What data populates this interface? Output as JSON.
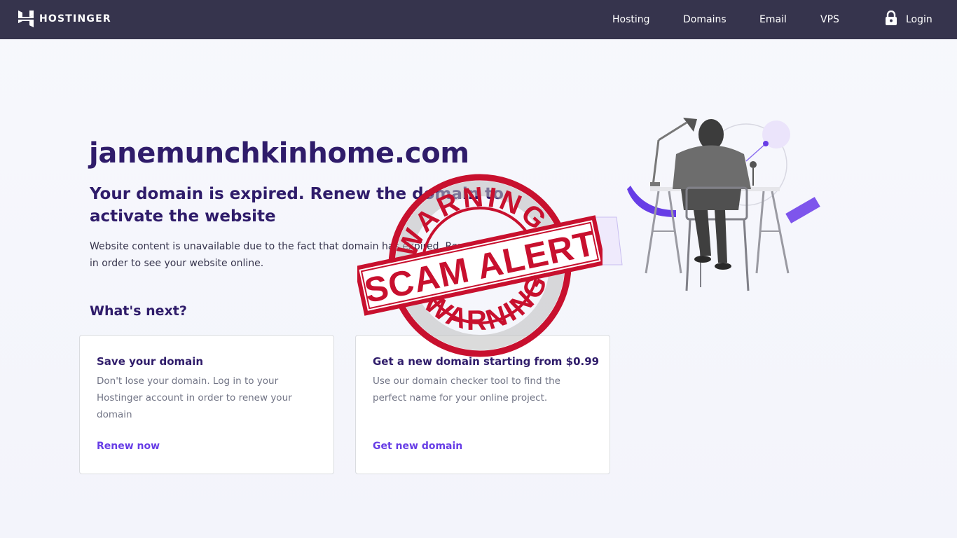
{
  "header": {
    "brand": "HOSTINGER",
    "nav": {
      "hosting": "Hosting",
      "domains": "Domains",
      "email": "Email",
      "vps": "VPS",
      "login": "Login"
    }
  },
  "main": {
    "domain": "janemunchkinhome.com",
    "headline": "Your domain is expired. Renew the domain to activate the website",
    "description": "Website content is unavailable due to the fact that domain has expired. Renew your domain in order to see your website online.",
    "whats_next": "What's next?"
  },
  "cards": [
    {
      "title": "Save your domain",
      "text": "Don't lose your domain. Log in to your Hostinger account in order to renew your domain",
      "link": "Renew now"
    },
    {
      "title": "Get a new domain starting from $0.99",
      "text": "Use our domain checker tool to find the perfect name for your online project.",
      "link": "Get new domain"
    }
  ],
  "stamp": {
    "top_text": "WARNING",
    "center_text": "SCAM ALERT",
    "bottom_text": "WARNING"
  },
  "colors": {
    "header_bg": "#36344d",
    "primary_dark": "#2f1c6a",
    "accent": "#673de6",
    "stamp_red": "#c8102e"
  },
  "icons": [
    "hostinger-logo-icon",
    "lock-icon"
  ]
}
